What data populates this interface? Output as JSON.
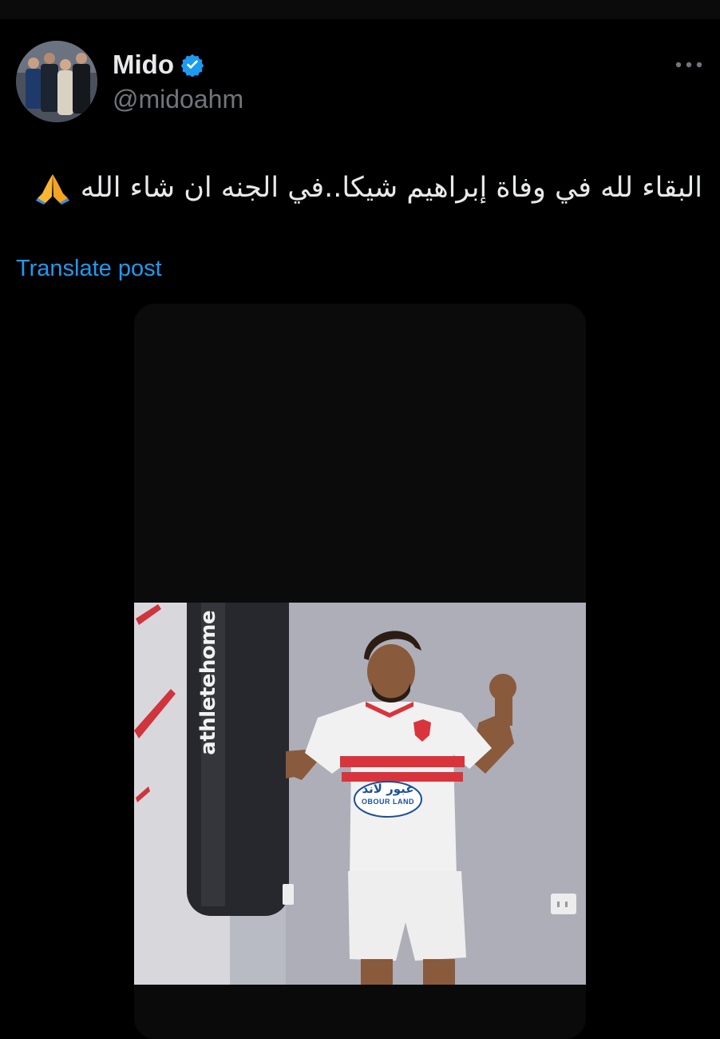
{
  "user": {
    "display_name": "Mido",
    "handle": "@midoahm",
    "verified": true,
    "avatar_icon": "profile-photo"
  },
  "post": {
    "text": "البقاء لله في وفاة إبراهيم شيكا..في الجنه ان شاء الله",
    "emoji": "folded-hands-emoji",
    "translate_label": "Translate post"
  },
  "media": {
    "bag_brand": "athletehome",
    "sponsor_ar": "عبور لاند",
    "sponsor_en": "OBOUR LAND"
  },
  "colors": {
    "background": "#000000",
    "text_primary": "#e7e9ea",
    "text_secondary": "#71767b",
    "accent": "#1d9bf0"
  }
}
